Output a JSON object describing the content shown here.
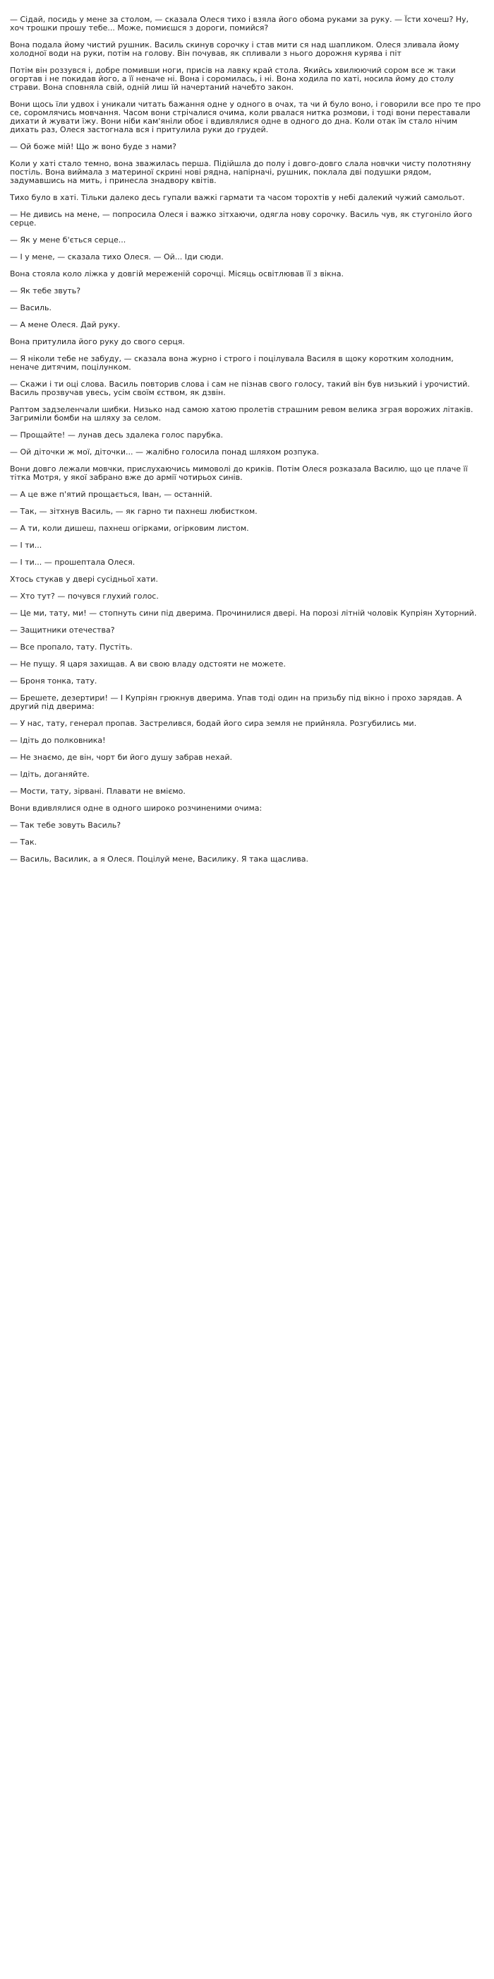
{
  "document": {
    "paragraphs": [
      "— Сідай, посидь у мене за столом, — сказала Олеся тихо і взяла його обома руками за руку. — Їсти хочеш? Ну, хоч трошки  прошу тебе... Може, помиєшся з дороги, помийся?",
      "Вона подала йому чистий рушник. Василь скинув сорочку і став мити ся над шапликом. Олеся зливала йому холодної води на руки, потім на голову. Він почував, як спливали з нього дорожня курява і піт",
      "Потім він роззувся і, добре помивши ноги, присів на лавку край стола. Якийсь хвилюючий сором все ж таки огортав і не покидав його, а її неначе ні. Вона і соромилась, і ні. Вона ходила по хаті, носила йому до столу страви. Вона сповняла свій, одній лиш їй начертаний начебто закон.",
      "Вони щось їли удвох і уникали читать бажання одне у одного в очах, та чи й було воно, і говорили все про те про се, соромлячись мовчання. Часом вони стрічалися очима, коли рвалася нитка розмови, і тоді вони переставали дихати й жувати їжу. Вони ніби кам'яніли обоє і вдивлялися одне в одного до дна. Коли отак їм стало нічим дихать раз, Олеся застогнала вся і притулила руки до грудей.",
      "— Ой боже мій! Що ж воно буде з нами?",
      "Коли у хаті стало темно, вона зважилась перша. Підійшла до полу і довго-довго слала новчки чисту полотняну постіль. Вона виймала з материної скрині нові рядна, напірначі, рушник, поклала дві подушки рядом, задумавшись на мить, і принесла знадвору квітів.",
      "Тихо було в хаті. Тільки далеко десь гупали важкі гармати та часом торохтів у небі далекий чужий самольот.",
      "— Не дивись на мене, — попросила Олеся і важко зітхаючи, одягла нову сорочку. Василь чув, як стугоніло його серце.",
      "— Як у мене б'ється серце...",
      "— І у мене, — сказала тихо Олеся. — Ой... Іди сюди.",
      "Вона стояла коло ліжка у довгій мереженій сорочці. Місяць освітлював її з вікна.",
      "— Як тебе звуть?",
      "— Василь.",
      "— А мене Олеся. Дай руку.",
      "Вона притулила його руку до свого серця.",
      "— Я ніколи тебе не забуду, — сказала вона журно і строго і поцілувала Василя в щоку коротким холодним, неначе дитячим, поцілунком.",
      "— Скажи і ти оці слова. Василь повторив слова і сам не пізнав свого голосу, такий він був низький і урочистий.  Василь прозвучав увесь, усім своїм єством, як дзвін.",
      "Раптом задзеленчали шибки. Низько над самою хатою пролетів страшним ревом велика зграя ворожих літаків. Загриміли бомби на шляху за селом.",
      "— Прощайте! — лунав десь здалека голос парубка.",
      "— Ой діточки ж мої, діточки... — жалібно голосила понад шляхом розпука.",
      "Вони довго лежали мовчки, прислухаючись мимоволі до криків. Потім Олеся розказала Василю, що це плаче її тітка Мотря, у якої забрано вже до армії чотирьох синів.",
      "— А це вже п'ятий прощається, Іван, — останній.",
      "— Так, — зітхнув Василь, — як гарно ти пахнеш любистком.",
      "— А ти, коли дишеш, пахнеш огірками, огірковим листом.",
      "— І ти...",
      "— І ти... — прошептала Олеся.",
      "Хтось стукав у двері сусідньої хати.",
      "— Хто тут? — почувся глухий голос.",
      "— Це ми, тату, ми! — стопнуть сини під дверима. Прочинилися двері. На порозі літній чоловік Купріян Хуторний.",
      "— Защитники отечества?",
      "— Все пропало, тату. Пустіть.",
      "— Не пущу. Я царя захищав. А ви свою владу одстояти не можете.",
      "— Броня тонка, тату.",
      "— Брешете, дезертири! — І Купріян грюкнув дверима. Упав тоді один на призьбу під вікно і прохо зарядав. А другий під дверима:",
      "— У нас, тату, генерал пропав. Застрелився, бодай його сира земля не прийняла. Розгубились ми.",
      "— Ідіть до полковника!",
      "— Не знаємо, де він, чорт би його душу забрав нехай.",
      "— Ідіть, доганяйте.",
      "— Мости, тату, зірвані. Плавати не вміємо.",
      "Вони вдивлялися одне в одного широко розчиненими очима:",
      "— Так тебе зовуть Василь?",
      "— Так.",
      "— Василь, Василик, а я Олеся. Поцілуй мене,  Василику. Я така щаслива."
    ]
  }
}
